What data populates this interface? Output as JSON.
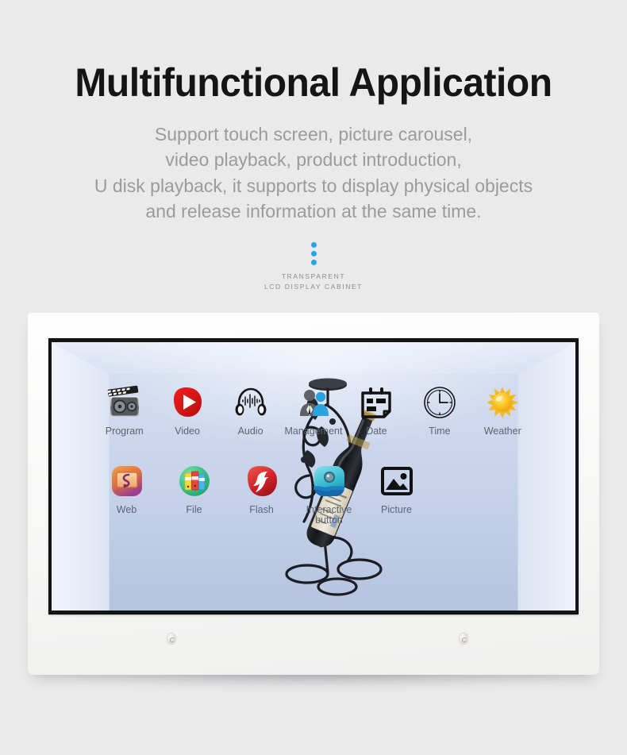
{
  "page": {
    "background_color": "#eaeaea"
  },
  "header": {
    "title": "Multifunctional Application",
    "subtitle_lines": [
      "Support touch screen, picture carousel,",
      "video playback, product introduction,",
      "U disk playback, it supports to display physical objects",
      "and release information at the same time."
    ]
  },
  "brand": {
    "dot_color": "#22a7ec",
    "dot_count": 3,
    "line1": "TRANSPARENT",
    "line2": "LCD DISPLAY CABINET"
  },
  "device": {
    "type": "transparent-lcd-display-cabinet",
    "frame_color": "#f7f7f6",
    "bezel_color": "#151515",
    "screen_watermark": "",
    "display_object": "wine-bottle-in-iron-holder"
  },
  "screen": {
    "icon_rows": [
      [
        {
          "label": "Program",
          "icon": "film-clapper-icon"
        },
        {
          "label": "Video",
          "icon": "play-button-icon"
        },
        {
          "label": "Audio",
          "icon": "headphones-icon"
        },
        {
          "label": "Management",
          "icon": "people-icon"
        },
        {
          "label": "Date",
          "icon": "calendar-icon"
        },
        {
          "label": "Time",
          "icon": "clock-icon"
        },
        {
          "label": "Weather",
          "icon": "sun-icon"
        }
      ],
      [
        {
          "label": "Web",
          "icon": "browser-icon"
        },
        {
          "label": "File",
          "icon": "folders-icon"
        },
        {
          "label": "Flash",
          "icon": "flash-icon"
        },
        {
          "label": "Interactive\nbutton",
          "icon": "interactive-button-icon"
        },
        {
          "label": "Picture",
          "icon": "image-icon"
        }
      ]
    ]
  },
  "colors": {
    "title": "#151515",
    "subtitle": "#9b9b9b",
    "icon_label": "#5e6470",
    "accent_blue": "#22a7ec",
    "video_red": "#e30613",
    "flash_red": "#cf2027",
    "file_green": "#3fbf7f",
    "weather_yellow": "#f6c026"
  }
}
